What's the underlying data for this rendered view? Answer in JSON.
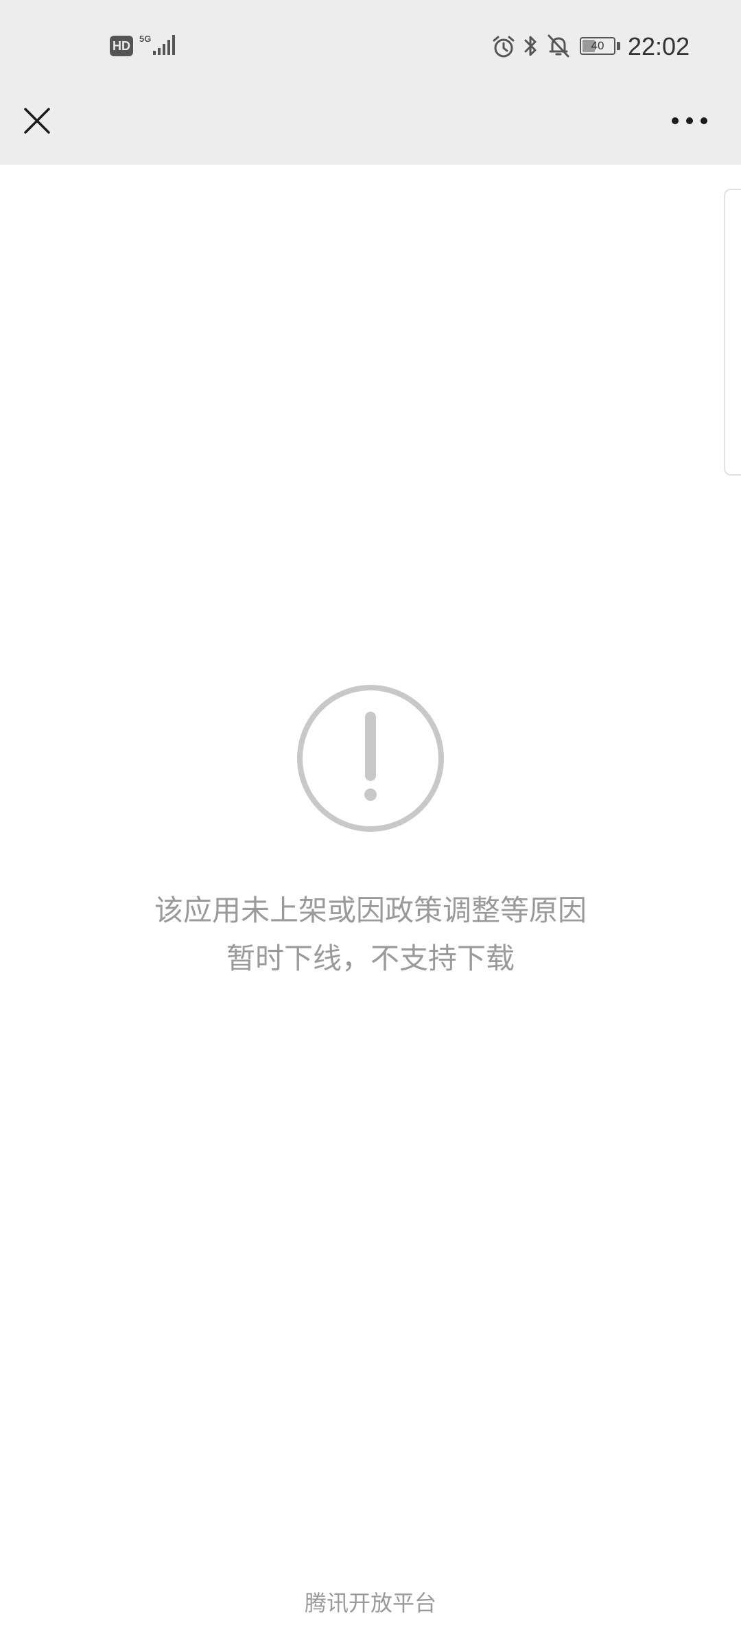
{
  "status_bar": {
    "hd_label": "HD",
    "network_type": "5G",
    "battery_level": "40",
    "battery_fraction": 0.4,
    "time": "22:02",
    "icons": [
      "signal-icon",
      "alarm-icon",
      "bluetooth-icon",
      "bell-off-icon",
      "battery-icon"
    ]
  },
  "title_bar": {
    "close_icon": "close-icon",
    "more_icon": "more-options-icon"
  },
  "main": {
    "status_icon": "exclamation-circle-icon",
    "message_lines": [
      "该应用未上架或因政策调整等原因",
      "暂时下线，不支持下载"
    ]
  },
  "footer": {
    "text": "腾讯开放平台"
  },
  "colors": {
    "header_background": "#ededed",
    "page_background": "#ffffff",
    "muted_text": "#9a9a9a",
    "icon_gray": "#c8c8c8"
  }
}
